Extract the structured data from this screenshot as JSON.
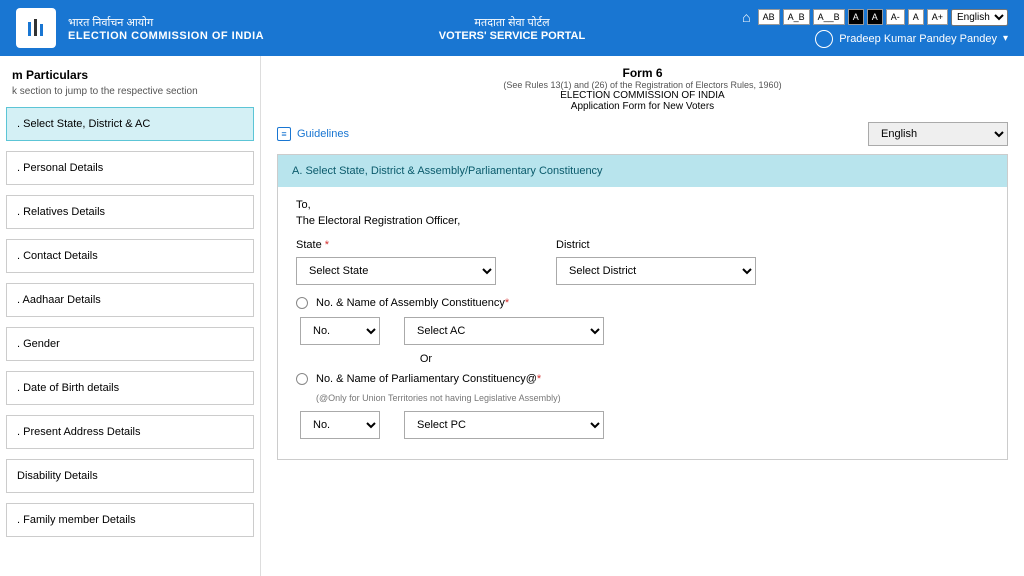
{
  "header": {
    "hindi_title": "भारत निर्वाचन आयोग",
    "eng_title": "ELECTION COMMISSION OF INDIA",
    "center_hindi": "मतदाता सेवा पोर्टल",
    "center_eng": "VOTERS' SERVICE PORTAL",
    "access": {
      "b1": "AB",
      "b2": "A_B",
      "b3": "A__B",
      "b4": "A",
      "b5": "A",
      "b6": "A-",
      "b7": "A",
      "b8": "A+"
    },
    "lang": "English",
    "user_name": "Pradeep Kumar Pandey Pandey"
  },
  "sidebar": {
    "title": "m Particulars",
    "subtitle": "k section to jump to the respective section",
    "items": [
      ". Select State, District & AC",
      ". Personal Details",
      ". Relatives Details",
      ". Contact Details",
      ". Aadhaar Details",
      ". Gender",
      ". Date of Birth details",
      ". Present Address Details",
      "  Disability Details",
      ". Family member Details"
    ]
  },
  "form": {
    "title": "Form 6",
    "rules": "(See Rules 13(1) and (26) of the Registration of Electors Rules, 1960)",
    "org": "ELECTION COMMISSION OF INDIA",
    "desc": "Application Form for New Voters",
    "guidelines": "Guidelines",
    "lang_option": "English",
    "section_a": "A. Select State, District & Assembly/Parliamentary Constituency",
    "to": "To,",
    "ero": "The Electoral Registration Officer,",
    "state_label": "State",
    "district_label": "District",
    "state_ph": "Select State",
    "district_ph": "Select District",
    "ac_label": "No. & Name of Assembly Constituency",
    "no_ph": "No.",
    "ac_ph": "Select AC",
    "or": "Or",
    "pc_label": "No. & Name of Parliamentary Constituency@",
    "pc_note": "(@Only for Union Territories not having Legislative Assembly)",
    "pc_ph": "Select PC"
  }
}
